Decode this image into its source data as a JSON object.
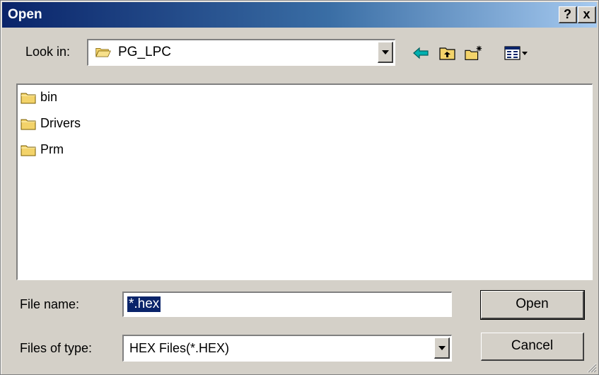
{
  "window": {
    "title": "Open",
    "help_label": "?",
    "close_label": "x"
  },
  "toolbar": {
    "lookin_label": "Look in:",
    "lookin_value": "PG_LPC",
    "tools": [
      "back-arrow-icon",
      "up-one-level-icon",
      "new-folder-icon",
      "view-menu-icon"
    ]
  },
  "files": [
    {
      "label": "bin",
      "icon": "folder-icon"
    },
    {
      "label": "Drivers",
      "icon": "folder-icon"
    },
    {
      "label": "Prm",
      "icon": "folder-icon"
    }
  ],
  "form": {
    "filename_label": "File name:",
    "filename_value": "*.hex",
    "filetype_label": "Files of type:",
    "filetype_value": "HEX Files(*.HEX)"
  },
  "buttons": {
    "open": "Open",
    "cancel": "Cancel"
  },
  "colors": {
    "title_start": "#0a246a",
    "title_end": "#a6caf0",
    "face": "#d4d0c8",
    "selection": "#0a246a",
    "folder": "#f3d36a",
    "arrow": "#00a0a0"
  }
}
